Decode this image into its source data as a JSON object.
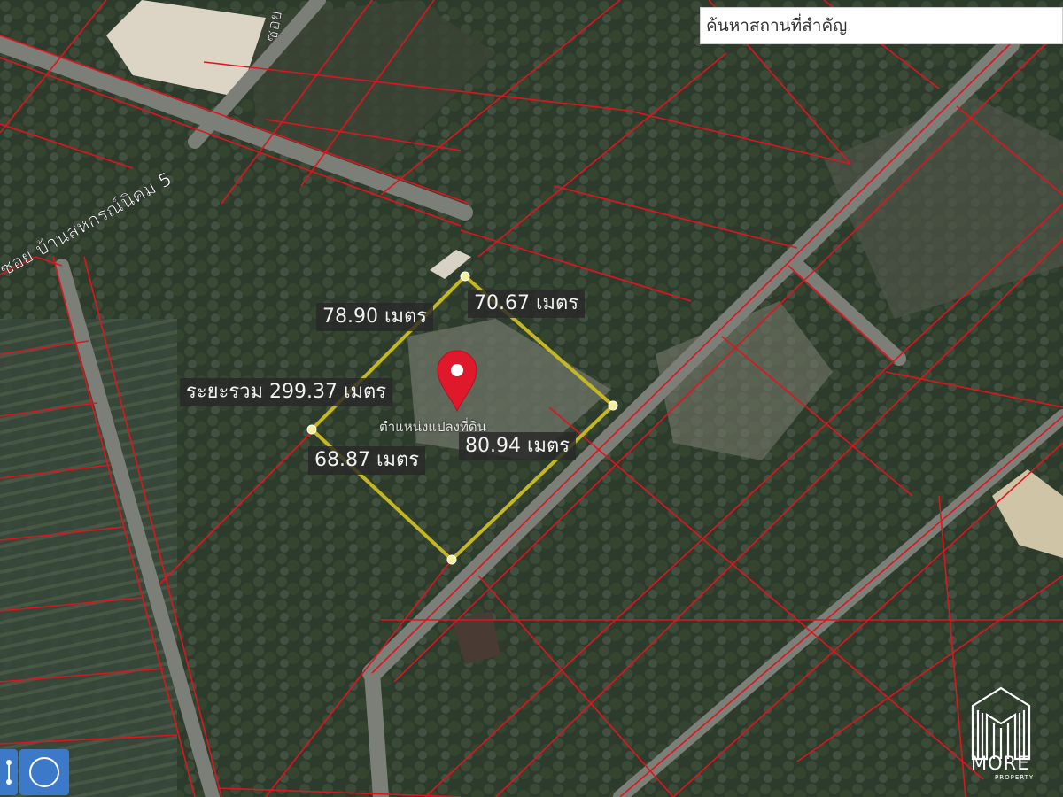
{
  "search": {
    "placeholder": "ค้นหาสถานที่สำคัญ"
  },
  "map": {
    "road_labels": [
      "ซอย บ้านสหกรณ์นิคม 5",
      "ซอย"
    ],
    "plot_label": "ตำแหน่งแปลงที่ดิน"
  },
  "measurements": {
    "side_nw": "78.90 เมตร",
    "side_ne": "70.67 เมตร",
    "total": "ระยะรวม 299.37 เมตร",
    "side_sw": "68.87 เมตร",
    "side_se": "80.94 เมตร"
  },
  "logo": {
    "name": "MORE",
    "sub": "PROPERTY"
  },
  "colors": {
    "parcel_line": "#e0141e",
    "measure_line": "#c4b624",
    "marker": "#e0182c",
    "tool_button": "#3d79c9"
  },
  "icons": {
    "marker": "map-pin-icon",
    "tool": "circle-draw-icon"
  }
}
